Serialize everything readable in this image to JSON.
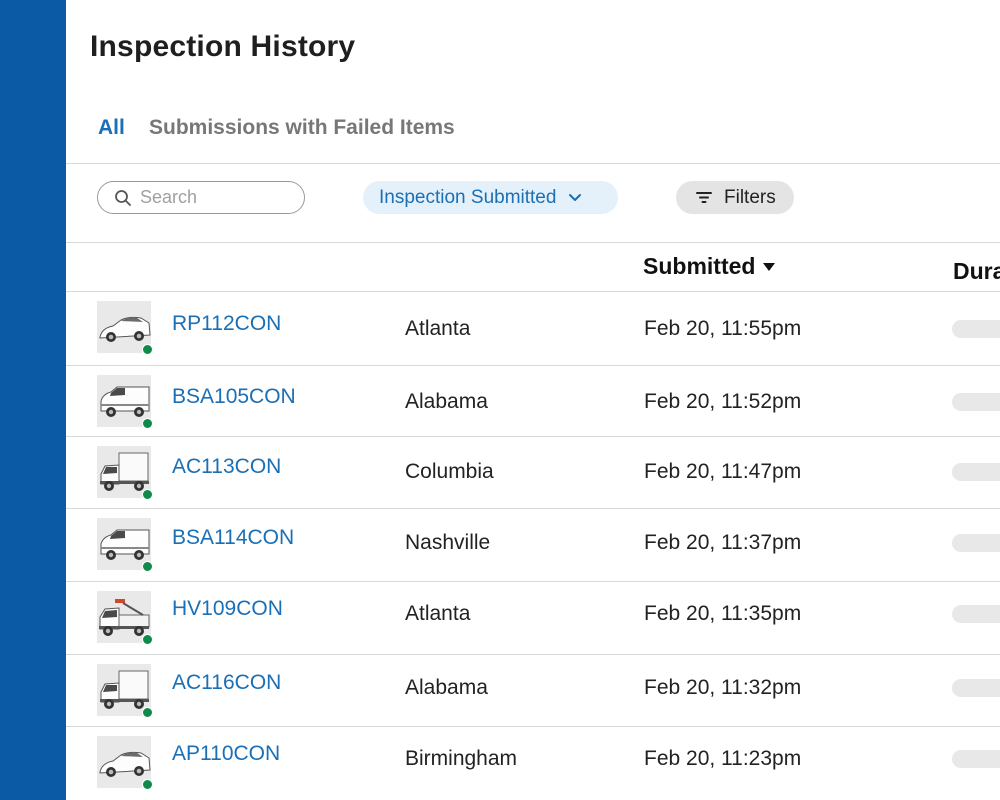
{
  "page": {
    "title": "Inspection History"
  },
  "tabs": [
    {
      "label": "All",
      "active": true
    },
    {
      "label": "Submissions with Failed Items",
      "active": false
    }
  ],
  "toolbar": {
    "search_placeholder": "Search",
    "status_filter": "Inspection Submitted",
    "filters_label": "Filters"
  },
  "table": {
    "columns": {
      "submitted": "Submitted",
      "duration": "Dura"
    },
    "rows": [
      {
        "vehicle": "RP112CON",
        "location": "Atlanta",
        "submitted": "Feb 20, 11:55pm",
        "icon": "car-icon"
      },
      {
        "vehicle": "BSA105CON",
        "location": "Alabama",
        "submitted": "Feb 20, 11:52pm",
        "icon": "van-icon"
      },
      {
        "vehicle": "AC113CON",
        "location": "Columbia",
        "submitted": "Feb 20, 11:47pm",
        "icon": "box-truck-icon"
      },
      {
        "vehicle": "BSA114CON",
        "location": "Nashville",
        "submitted": "Feb 20, 11:37pm",
        "icon": "van-icon"
      },
      {
        "vehicle": "HV109CON",
        "location": "Atlanta",
        "submitted": "Feb 20, 11:35pm",
        "icon": "tow-truck-icon"
      },
      {
        "vehicle": "AC116CON",
        "location": "Alabama",
        "submitted": "Feb 20, 11:32pm",
        "icon": "box-truck-icon"
      },
      {
        "vehicle": "AP110CON",
        "location": "Birmingham",
        "submitted": "Feb 20, 11:23pm",
        "icon": "car-icon"
      }
    ]
  },
  "colors": {
    "sidebar": "#0b5aa6",
    "accent": "#1a6fb5",
    "status_ok": "#0e8a4a"
  }
}
